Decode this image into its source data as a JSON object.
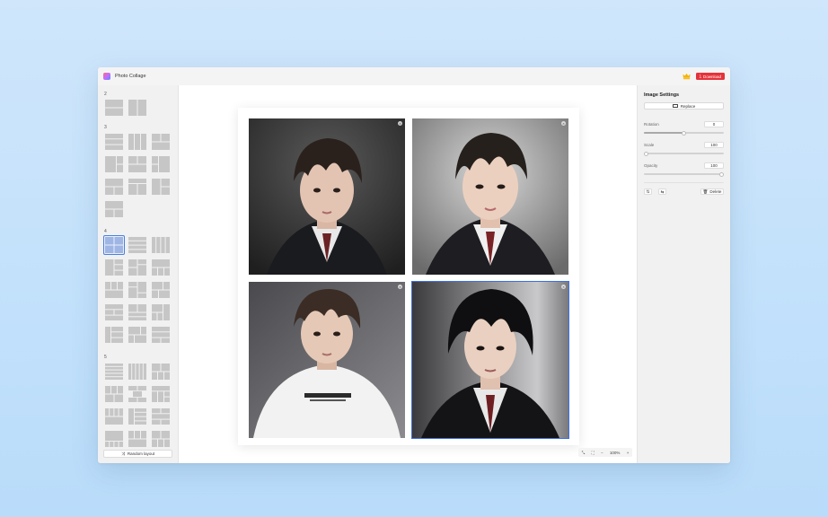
{
  "app": {
    "title": "Photo Collage",
    "download_label": "Download"
  },
  "sidebar": {
    "groups": [
      {
        "label": "2",
        "layouts": [
          "two-rows",
          "two-cols"
        ]
      },
      {
        "label": "3",
        "layouts": [
          "three-rows",
          "three-cols",
          "top-split",
          "left-big",
          "mid-wide",
          "right-big",
          "bottom-split",
          "top-wide-3",
          "left-split",
          "stacked-3"
        ]
      },
      {
        "label": "4",
        "layouts": [
          "grid-2x2",
          "four-rows",
          "four-cols",
          "left-big-4",
          "right-stack-4",
          "top-big-4",
          "mixed-a",
          "mixed-b",
          "mixed-c",
          "mixed-d",
          "mixed-e",
          "mixed-f",
          "mixed-g",
          "mixed-h",
          "mixed-i"
        ]
      },
      {
        "label": "5",
        "layouts": [
          "five-rows",
          "five-cols",
          "grid-5a",
          "grid-5b",
          "center-5",
          "grid-5c",
          "grid-5d",
          "grid-5e",
          "grid-5f",
          "grid-5g",
          "grid-5h",
          "grid-5i"
        ]
      }
    ],
    "selected_layout": "grid-2x2",
    "random_label": "Random layout"
  },
  "canvas": {
    "photos": [
      {
        "id": "photo-1",
        "close": "×",
        "tone": "dark-bg"
      },
      {
        "id": "photo-2",
        "close": "×",
        "tone": "studio-light"
      },
      {
        "id": "photo-3",
        "close": "×",
        "tone": "white-shirt"
      },
      {
        "id": "photo-4",
        "close": "×",
        "tone": "dark-light"
      }
    ],
    "selected_photo": "photo-4",
    "zoom": "100%",
    "zoom_minus": "−",
    "zoom_plus": "+"
  },
  "settings": {
    "title": "Image Settings",
    "replace_label": "Replace",
    "rotation_label": "Rotation",
    "rotation_value": "0",
    "scale_label": "Scale",
    "scale_value": "100",
    "opacity_label": "Opacity",
    "opacity_value": "100",
    "delete_label": "Delete"
  },
  "colors": {
    "accent": "#3d6fe0",
    "download": "#e5323a",
    "crown": "#f5b400"
  }
}
